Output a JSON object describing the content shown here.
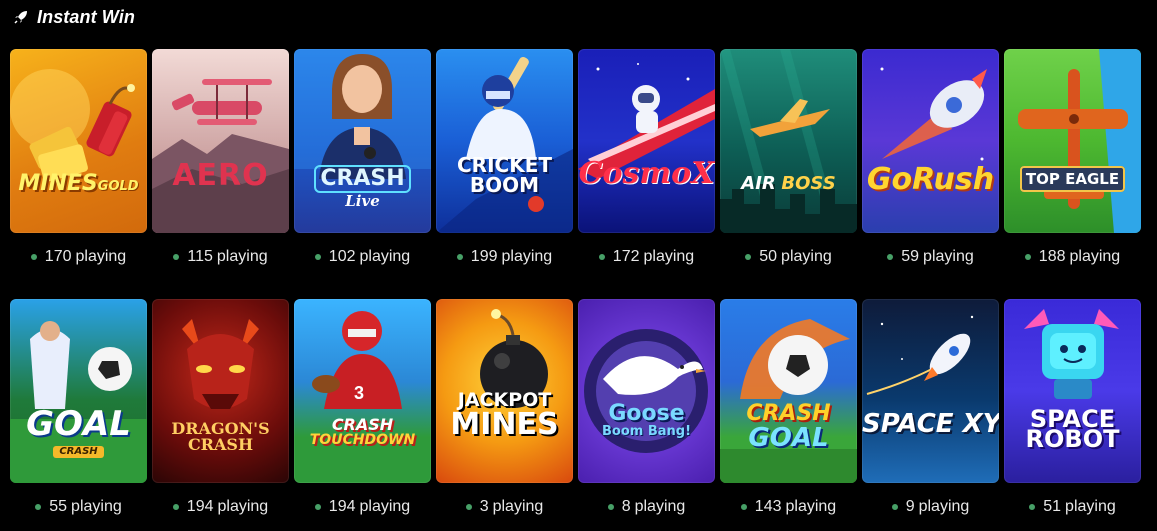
{
  "section": {
    "icon": "rocket-icon",
    "title": "Instant Win"
  },
  "rows": [
    [
      {
        "title": "MINES",
        "subtitle": "GOLD",
        "count": "170",
        "unit": "playing"
      },
      {
        "title": "AERO",
        "count": "115",
        "unit": "playing"
      },
      {
        "title": "CRASH",
        "subtitle": "Live",
        "count": "102",
        "unit": "playing"
      },
      {
        "title": "CRICKET",
        "subtitle": "BOOM",
        "count": "199",
        "unit": "playing"
      },
      {
        "title": "CosmoX",
        "count": "172",
        "unit": "playing"
      },
      {
        "title": "AIR",
        "subtitle": "BOSS",
        "count": "50",
        "unit": "playing"
      },
      {
        "title": "GoRush",
        "count": "59",
        "unit": "playing"
      },
      {
        "title": "TOP EAGLE",
        "count": "188",
        "unit": "playing"
      }
    ],
    [
      {
        "title": "GOAL",
        "subtitle": "CRASH",
        "count": "55",
        "unit": "playing"
      },
      {
        "title": "DRAGON'S",
        "subtitle": "CRASH",
        "count": "194",
        "unit": "playing"
      },
      {
        "title": "CRASH",
        "subtitle": "TOUCHDOWN",
        "count": "194",
        "unit": "playing"
      },
      {
        "title": "JACKPOT",
        "subtitle": "MINES",
        "count": "3",
        "unit": "playing"
      },
      {
        "title": "Goose",
        "subtitle": "Boom Bang!",
        "count": "8",
        "unit": "playing"
      },
      {
        "title": "CRASH",
        "subtitle": "GOAL",
        "count": "143",
        "unit": "playing"
      },
      {
        "title": "SPACE XY",
        "count": "9",
        "unit": "playing"
      },
      {
        "title": "SPACE",
        "subtitle": "ROBOT",
        "count": "51",
        "unit": "playing"
      }
    ]
  ]
}
